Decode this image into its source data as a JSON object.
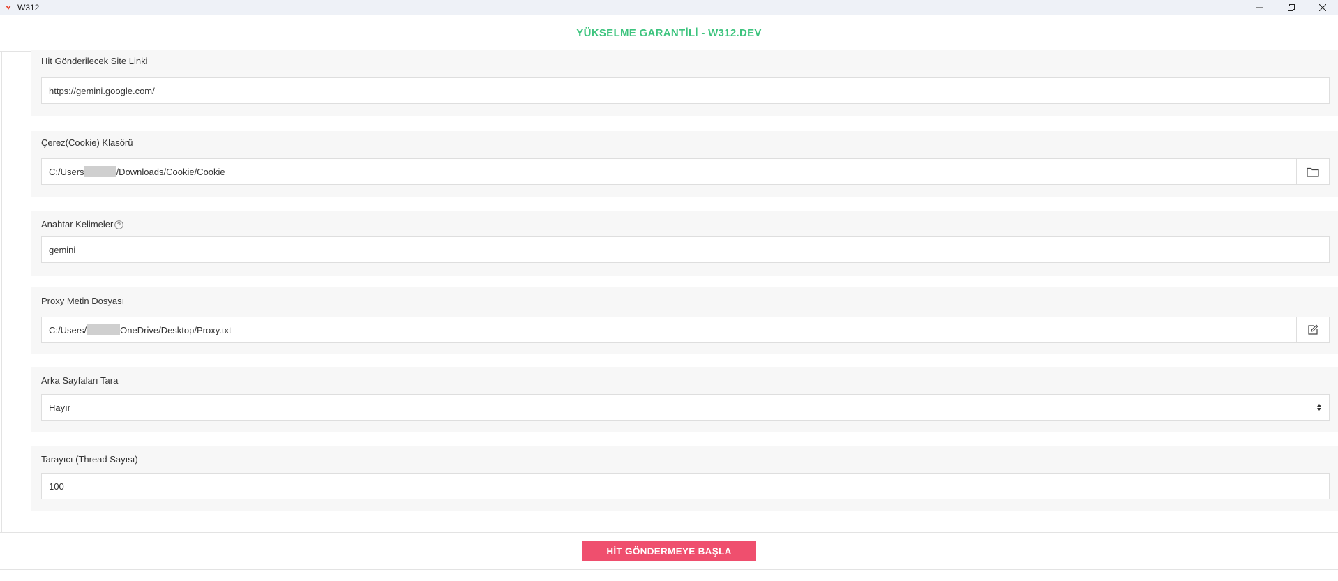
{
  "window": {
    "title": "W312"
  },
  "header": {
    "title": "YÜKSELME GARANTİLİ - W312.DEV"
  },
  "fields": {
    "site_link": {
      "label": "Hit Gönderilecek Site Linki",
      "value": "https://gemini.google.com/"
    },
    "cookie_folder": {
      "label": "Çerez(Cookie) Klasörü",
      "value_prefix": "C:/Users",
      "value_suffix": "/Downloads/Cookie/Cookie"
    },
    "keywords": {
      "label": "Anahtar Kelimeler",
      "value": "gemini"
    },
    "proxy_file": {
      "label": "Proxy Metin Dosyası",
      "value_prefix": "C:/Users/",
      "value_suffix": "OneDrive/Desktop/Proxy.txt"
    },
    "scan_back_pages": {
      "label": "Arka Sayfaları Tara",
      "value": "Hayır"
    },
    "threads": {
      "label": "Tarayıcı (Thread Sayısı)",
      "value": "100"
    }
  },
  "footer": {
    "start_label": "HİT GÖNDERMEYE BAŞLA"
  },
  "colors": {
    "accent": "#3dc47e",
    "button": "#ef4f6e",
    "section_bg": "#f7f7f7"
  }
}
